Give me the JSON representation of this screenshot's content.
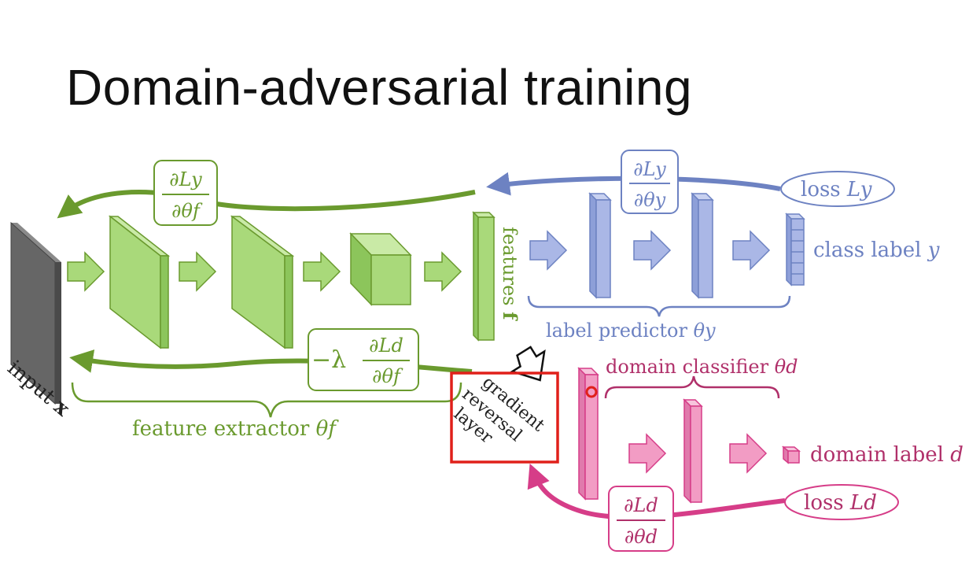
{
  "slide": {
    "title": "Domain-adversarial training"
  },
  "labels": {
    "input": "input ",
    "input_var": "x",
    "features": "features ",
    "features_var": "f",
    "feature_extractor": "feature extractor ",
    "feature_extractor_param": "θf",
    "label_predictor": "label predictor ",
    "label_predictor_param": "θy",
    "domain_classifier": "domain classifier ",
    "domain_classifier_param": "θd",
    "class_label": "class label ",
    "class_label_var": "y",
    "domain_label": "domain label ",
    "domain_label_var": "d",
    "grl_line1": "gradient",
    "grl_line2": "reversal",
    "grl_line3": "layer"
  },
  "losses": {
    "loss_y": {
      "word": "loss ",
      "var": "Ly"
    },
    "loss_d": {
      "word": "loss ",
      "var": "Ld"
    }
  },
  "gradients": {
    "dLy_dtheta_f": {
      "num": "∂Ly",
      "den": "∂θf"
    },
    "dLy_dtheta_y": {
      "num": "∂Ly",
      "den": "∂θy"
    },
    "dLd_dtheta_d": {
      "num": "∂Ld",
      "den": "∂θd"
    },
    "neg_lambda_dLd_dtheta_f": {
      "prefix": "−λ",
      "num": "∂Ld",
      "den": "∂θf"
    }
  },
  "colors": {
    "green": "#6a9a2e",
    "green_fill": "#a9d97a",
    "green_side": "#8cc55b",
    "blue": "#6d82c2",
    "blue_fill": "#aab7e6",
    "pink": "#d63d88",
    "pink_fill": "#f29cc4",
    "magenta_text": "#b0306a",
    "highlight_box": "#e0201a",
    "input_layer": "#666666"
  }
}
